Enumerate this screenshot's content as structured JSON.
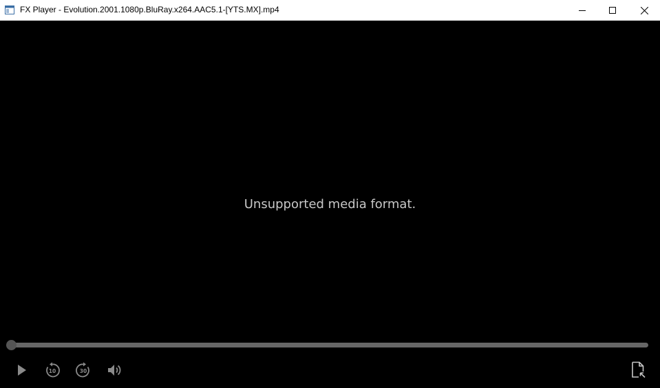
{
  "window": {
    "title": "FX Player - Evolution.2001.1080p.BluRay.x264.AAC5.1-[YTS.MX].mp4"
  },
  "player": {
    "message": "Unsupported media format.",
    "progress_fraction": 0.0,
    "controls": {
      "play_icon": "play-icon",
      "rewind_icon": "rewind-10-icon",
      "rewind_label": "10",
      "forward_icon": "forward-30-icon",
      "forward_label": "30",
      "volume_icon": "volume-icon",
      "open_file_icon": "open-file-icon"
    }
  },
  "colors": {
    "background": "#000000",
    "titlebar": "#ffffff",
    "message_text": "#c8c8c8",
    "seek_track": "#666666",
    "icon": "#8a8a8a"
  }
}
